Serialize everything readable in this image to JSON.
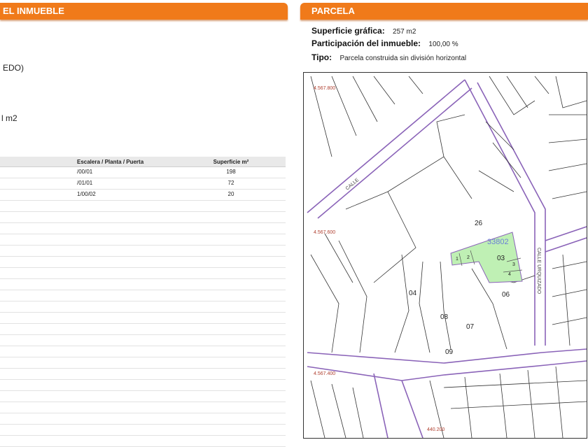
{
  "left_panel": {
    "header": "EL INMUEBLE",
    "fragments": [
      "EDO)",
      "l m2"
    ],
    "table": {
      "columns": [
        "Escalera / Planta / Puerta",
        "Superficie m²"
      ],
      "rows": [
        [
          "/00/01",
          "198"
        ],
        [
          "/01/01",
          "72"
        ],
        [
          "1/00/02",
          "20"
        ]
      ]
    }
  },
  "right_panel": {
    "header": "PARCELA",
    "superficie_label": "Superficie gráfica:",
    "superficie_value": "257 m2",
    "participacion_label": "Participación del inmueble:",
    "participacion_value": "100,00 %",
    "tipo_label": "Tipo:",
    "tipo_value": "Parcela construida sin división horizontal"
  },
  "map": {
    "coord_labels": [
      "4.567.800",
      "4.567.600",
      "4.567.400",
      "440.200"
    ],
    "street_labels": [
      "CALLE",
      "CALLE URQUIZADO"
    ],
    "parcel_labels": [
      "26",
      "03",
      "04",
      "06",
      "07",
      "08",
      "09"
    ],
    "highlight_ref": "33802",
    "highlight_numbers": [
      "1",
      "2",
      "3",
      "4"
    ],
    "colors": {
      "parcel_highlight": "#bff0b4",
      "street_line": "#8a63b8",
      "lot_line": "#333333"
    }
  }
}
